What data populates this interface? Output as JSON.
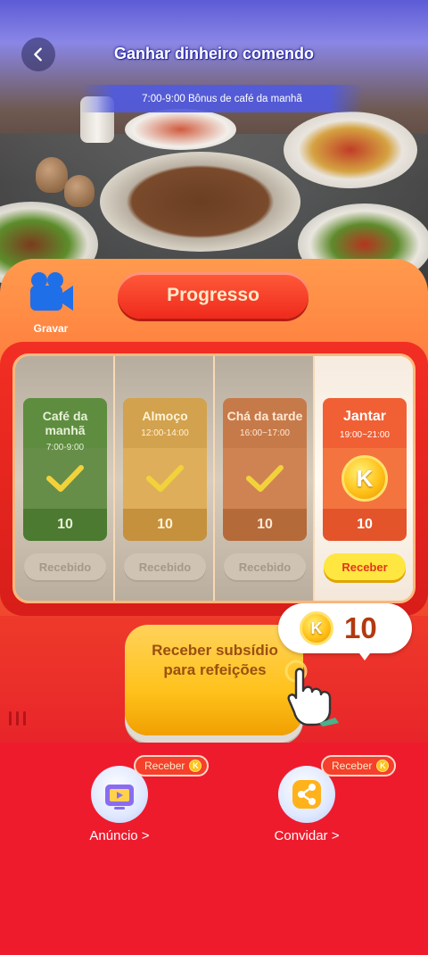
{
  "header": {
    "title": "Ganhar dinheiro comendo",
    "bonus_text": "7:00-9:00 Bônus de café da manhã"
  },
  "record": {
    "label": "Gravar"
  },
  "progress": {
    "title": "Progresso"
  },
  "meals": [
    {
      "name": "Café da manhã",
      "time": "7:00-9:00",
      "reward": "10",
      "button": "Recebido",
      "state": "received"
    },
    {
      "name": "Almoço",
      "time": "12:00-14:00",
      "reward": "10",
      "button": "Recebido",
      "state": "received"
    },
    {
      "name": "Chá da tarde",
      "time": "16:00~17:00",
      "reward": "10",
      "button": "Recebido",
      "state": "received"
    },
    {
      "name": "Jantar",
      "time": "19:00~21:00",
      "reward": "10",
      "button": "Receber",
      "state": "available"
    }
  ],
  "coin_symbol": "K",
  "cta": {
    "line1": "Receber subsídio",
    "line2": "para refeições"
  },
  "bubble": {
    "amount": "10"
  },
  "actions": [
    {
      "label": "Anúncio >",
      "tag": "Receber",
      "icon": "tv-icon"
    },
    {
      "label": "Convidar >",
      "tag": "Receber",
      "icon": "share-icon"
    }
  ],
  "colors": {
    "accent_red": "#ee1b2d",
    "coin_gold": "#ffc21a",
    "header_blue": "#5d5bd6"
  }
}
